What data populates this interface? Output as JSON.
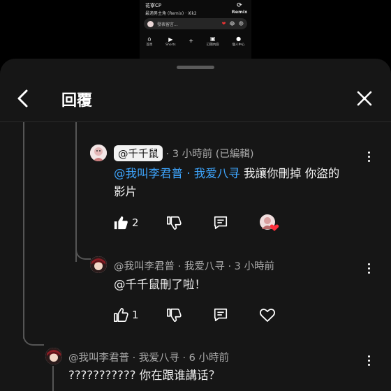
{
  "background_video": {
    "title": "花寧CP",
    "subtitle": "最適男主角 (Remix) · i6k2",
    "remix_label": "Remix",
    "comment_placeholder": "發表留言...",
    "emojis": [
      "❤",
      "😂",
      "😄"
    ],
    "nav": [
      "首頁",
      "Shorts",
      "+",
      "訂閱內容",
      "個人中心"
    ]
  },
  "header": {
    "title": "回覆"
  },
  "comments": [
    {
      "author": "@千千鼠",
      "meta": "· 3 小時前 (已編輯)",
      "mention": "@我叫李君普 · 我爱八寻",
      "text": " 我讓你刪掉 你盜的",
      "text_line2": "影片",
      "likes": "2"
    },
    {
      "author": "@我叫李君普 · 我爱八寻",
      "meta": "· 3 小時前",
      "text": "@千千鼠刪了啦！",
      "likes": "1"
    },
    {
      "author": "@我叫李君普 · 我爱八寻",
      "meta": "· 6 小時前",
      "text": "??????????? 你在跟谁講话？"
    }
  ]
}
